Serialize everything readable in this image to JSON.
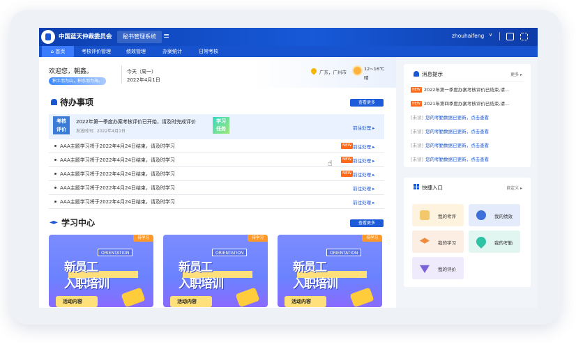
{
  "header": {
    "org_name": "中国蓝天仲裁委员会",
    "system_name": "秘书管理系统",
    "username": "zhouhaifeng"
  },
  "nav": {
    "tabs": [
      {
        "label": "首页",
        "active": true
      },
      {
        "label": "考核评价管理"
      },
      {
        "label": "绩效管理"
      },
      {
        "label": "办案统计"
      },
      {
        "label": "日常考核"
      }
    ]
  },
  "welcome": {
    "greeting": "欢迎您，朝鑫。",
    "tagline": "积土而为山，积水而为海。",
    "today": "今天（周一）",
    "date": "2022年4月1日",
    "location": "广东，广州市",
    "temperature": "12~16℃",
    "weather": "晴"
  },
  "todo": {
    "title": "待办事项",
    "more": "查看更多",
    "highlight": {
      "badge_line1": "考核",
      "badge_line2": "评价",
      "title": "2022年第一季度办案考核评价已开始，请及时完成评价",
      "time": "发送时间：2022年4月1日",
      "study_line1": "学习",
      "study_line2": "任务",
      "action": "前往处理 ▸"
    },
    "items": [
      {
        "text": "AAA主题学习将于2022年4月24日结束，请及时学习",
        "new": "NEW",
        "action": "前往处理 ▸"
      },
      {
        "text": "AAA主题学习将于2022年4月24日结束，请及时学习",
        "new": "NEW",
        "action": "前往处理 ▸"
      },
      {
        "text": "AAA主题学习将于2022年4月24日结束，请及时学习",
        "new": "NEW",
        "action": "前往处理 ▸"
      },
      {
        "text": "AAA主题学习将于2022年4月24日结束，请及时学习",
        "new": "",
        "action": "前往处理 ▸"
      },
      {
        "text": "AAA主题学习将于2022年4月24日结束，请及时学习",
        "new": "",
        "action": "前往处理 ▸"
      }
    ]
  },
  "learning": {
    "title": "学习中心",
    "more": "查看更多",
    "cards": [
      {
        "tag": "待学习",
        "orientation": "ORIENTATION",
        "line1": "新员工",
        "line2": "入职培训",
        "sub": "活动内容"
      },
      {
        "tag": "待学习",
        "orientation": "ORIENTATION",
        "line1": "新员工",
        "line2": "入职培训",
        "sub": "活动内容"
      },
      {
        "tag": "待学习",
        "orientation": "ORIENTATION",
        "line1": "新员工",
        "line2": "入职培训",
        "sub": "活动内容"
      }
    ]
  },
  "messages": {
    "title": "消息提示",
    "more": "更多 ▸",
    "items": [
      {
        "prefix": "NEW",
        "text": "2022年第一季度办案考核评价已结束,请..."
      },
      {
        "prefix": "NEW",
        "text": "2021年第四季度办案考核评价已结束,请..."
      },
      {
        "prefix": "[未读]",
        "text": "您的考勤数据已更新，点击查看"
      },
      {
        "prefix": "[未读]",
        "text": "您的考勤数据已更新，点击查看"
      },
      {
        "prefix": "[未读]",
        "text": "您的考勤数据已更新，点击查看"
      },
      {
        "prefix": "[未读]",
        "text": "您的考勤数据已更新，点击查看"
      }
    ]
  },
  "shortcuts": {
    "title": "快捷入口",
    "customize": "自定义 ▸",
    "items": [
      {
        "label": "我的考评",
        "bg": "#fdf3df",
        "icon": "#f3c76b"
      },
      {
        "label": "我的绩效",
        "bg": "#e4ecfb",
        "icon": "#3f6fd8"
      },
      {
        "label": "我的学习",
        "bg": "#fdeee4",
        "icon": "#f08a3c"
      },
      {
        "label": "我的考勤",
        "bg": "#e1f5f1",
        "icon": "#2fc3a6"
      },
      {
        "label": "我的评价",
        "bg": "#efeafc",
        "icon": "#7c62d8"
      }
    ]
  }
}
